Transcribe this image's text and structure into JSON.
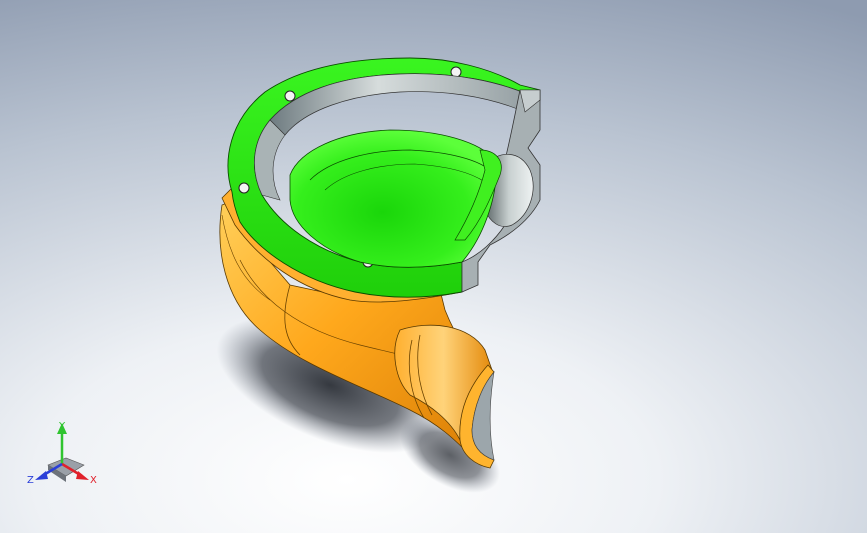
{
  "viewport": {
    "background_top": "#8e9bb0",
    "background_bottom": "#ffffff"
  },
  "model": {
    "flange_color": "#33ee11",
    "body_color": "#ffa81c",
    "wall_color": "#9fa8ab"
  },
  "triad": {
    "x_label": "X",
    "y_label": "Y",
    "z_label": "Z",
    "x_color": "#e0212b",
    "y_color": "#2fc42f",
    "z_color": "#2a3fd8"
  }
}
